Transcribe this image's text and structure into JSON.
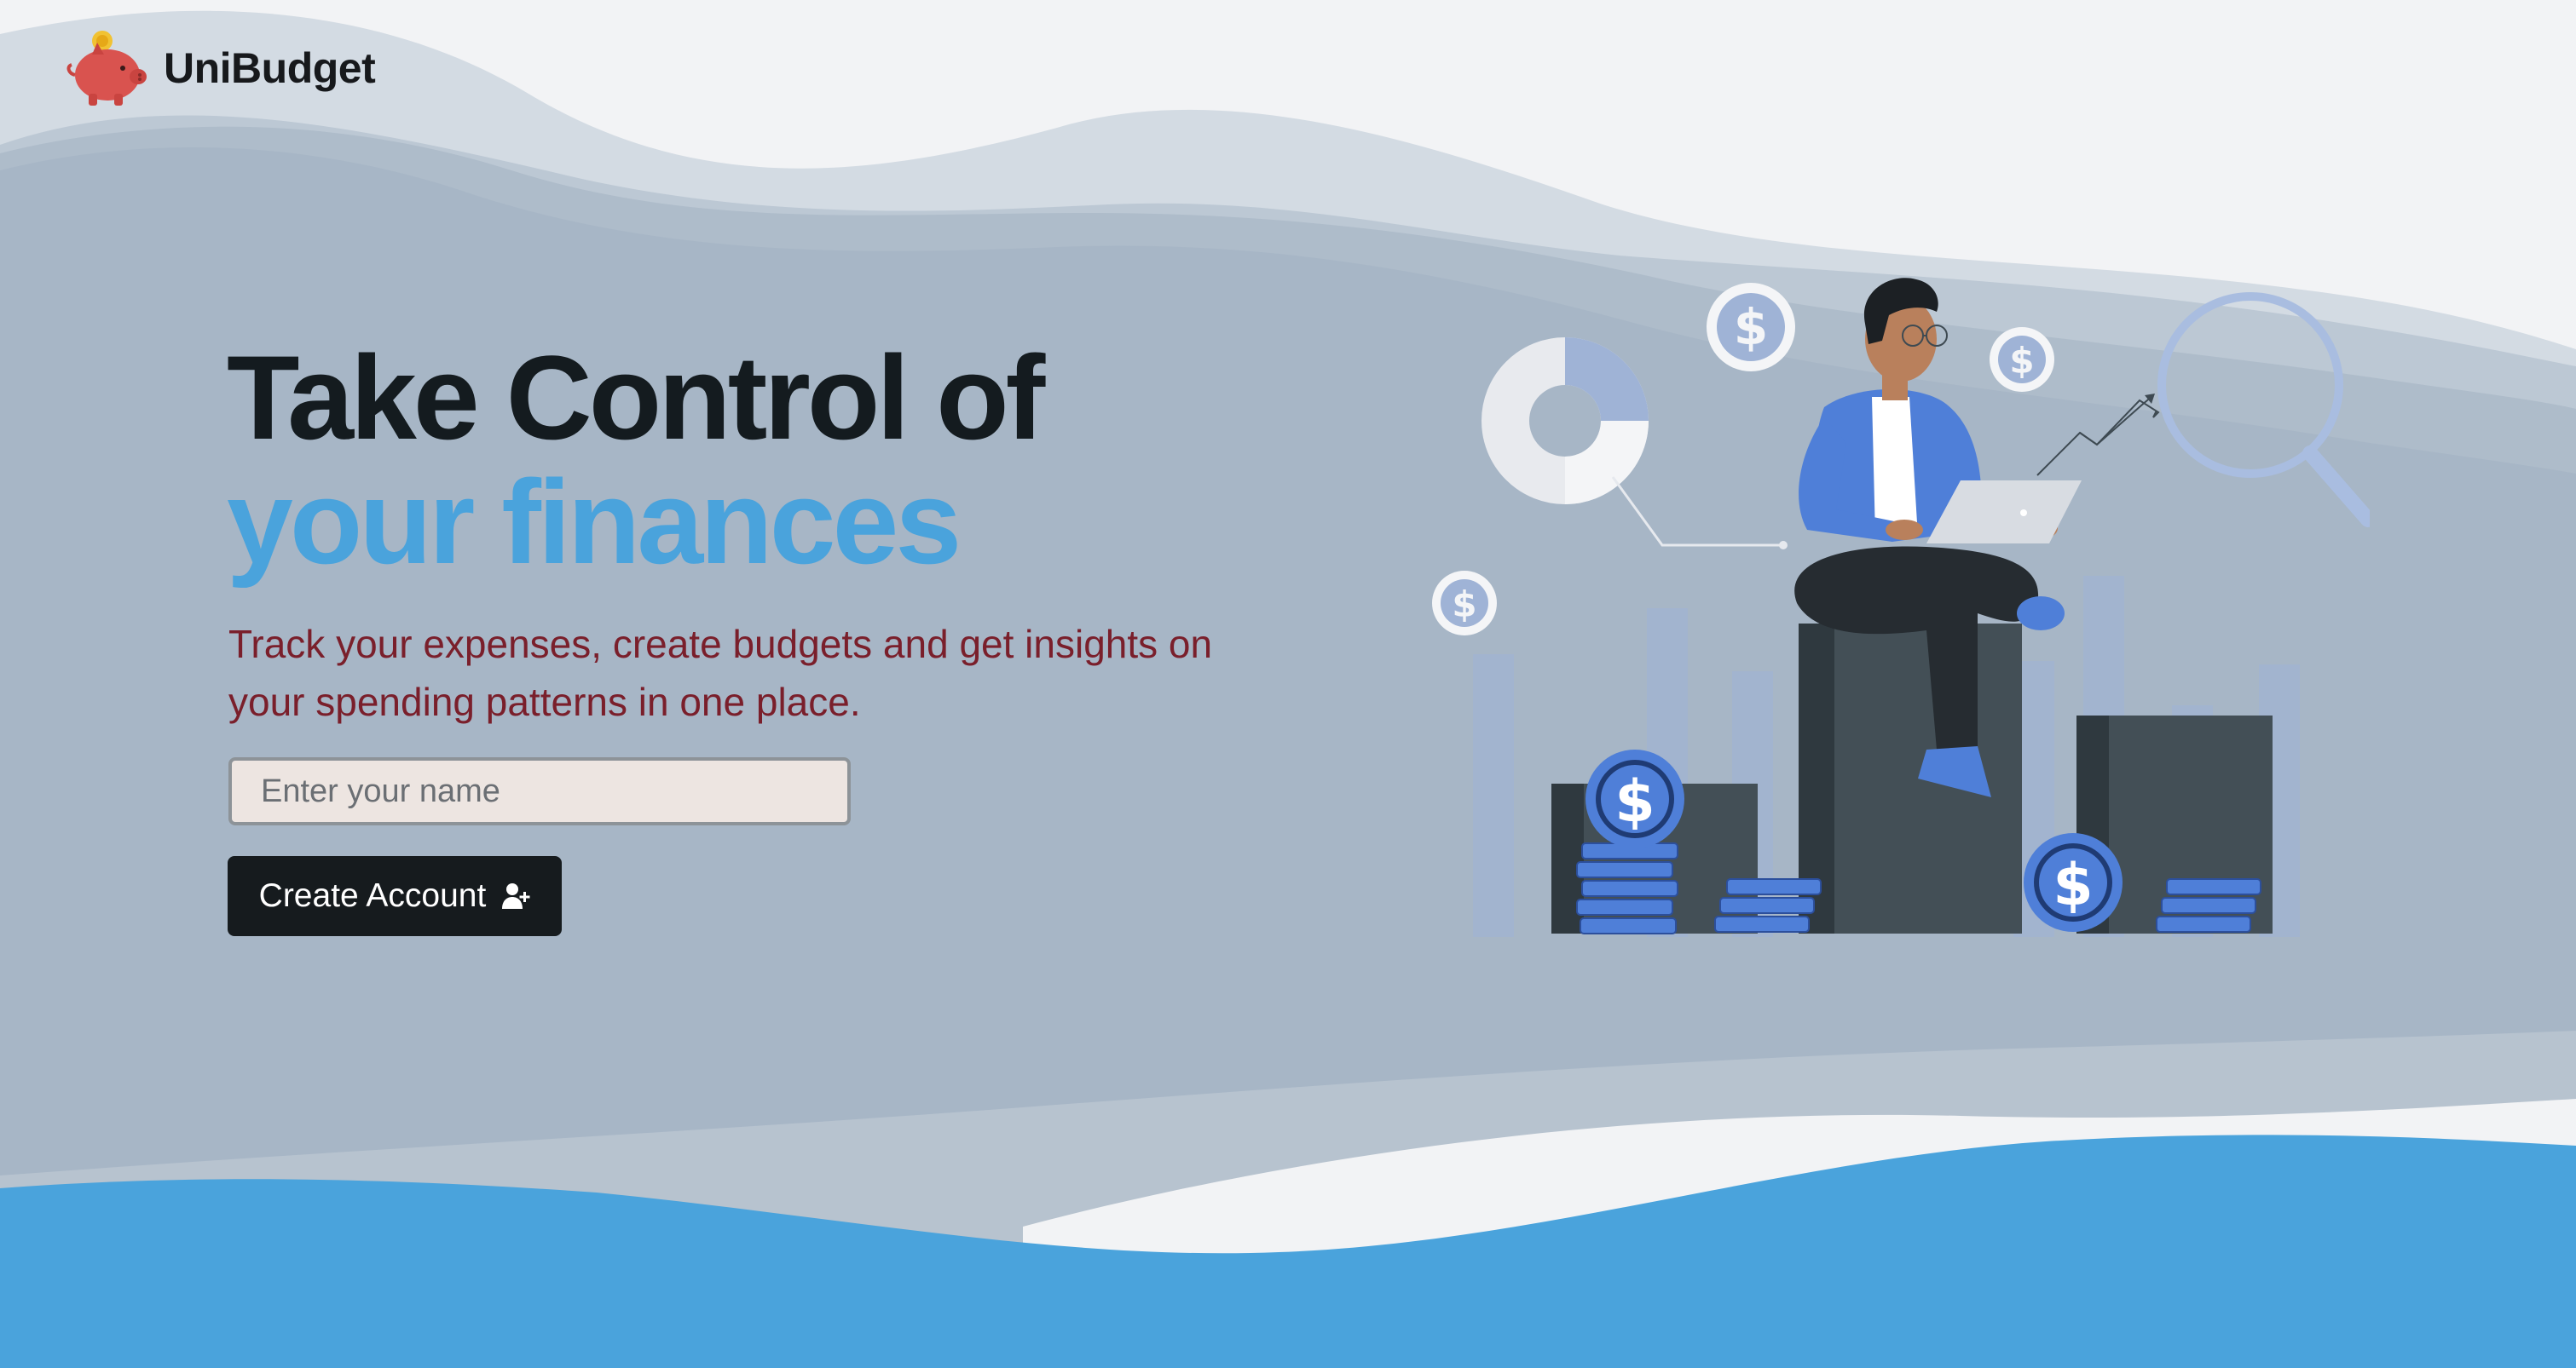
{
  "brand": {
    "name": "UniBudget",
    "logo_icon": "piggy-bank-icon"
  },
  "hero": {
    "title_line1": "Take Control of",
    "title_line2": "your finances",
    "subtitle": "Track your expenses, create budgets and get insights on your spending patterns in one place."
  },
  "form": {
    "name_placeholder": "Enter your name",
    "name_value": "",
    "submit_label": "Create Account",
    "submit_icon": "user-plus-icon"
  },
  "colors": {
    "accent_blue": "#4aa3dc",
    "title_dark": "#141b1f",
    "subtitle_maroon": "#7a1f2b",
    "button_dark": "#161b1e",
    "input_bg": "#ede5e1",
    "wave_gray": "#a3b2c3"
  }
}
